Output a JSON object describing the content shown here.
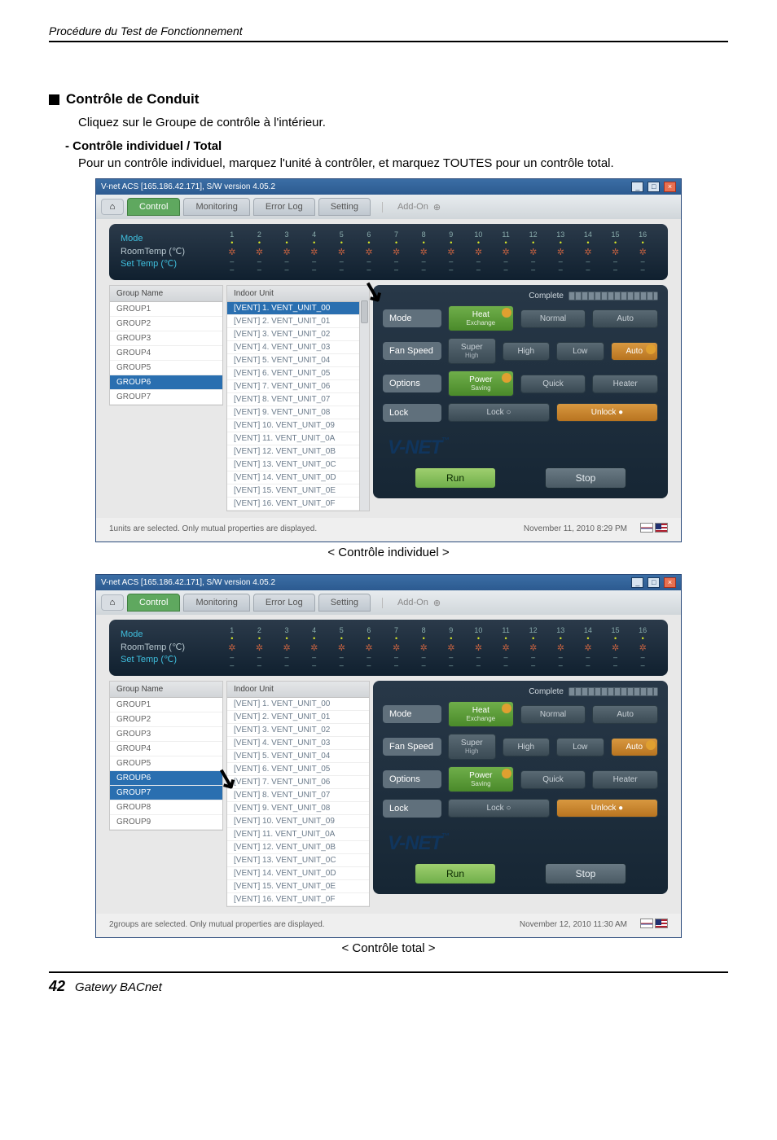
{
  "page": {
    "running_header": "Procédure du Test de Fonctionnement",
    "section_title": "Contrôle de Conduit",
    "intro": "Cliquez sur le Groupe de contrôle à l'intérieur.",
    "sub_title": "- Contrôle individuel / Total",
    "sub_body": "Pour un contrôle individuel, marquez l'unité à contrôler, et marquez TOUTES pour un contrôle total.",
    "caption1": "< Contrôle individuel >",
    "caption2": "< Contrôle total >",
    "footer_page": "42",
    "footer_product": "Gatewy BACnet"
  },
  "app": {
    "titlebar": "V-net ACS [165.186.42.171],   S/W version 4.05.2",
    "tabs": {
      "control": "Control",
      "monitoring": "Monitoring",
      "errorlog": "Error Log",
      "setting": "Setting",
      "addon": "Add-On"
    },
    "status_labels": {
      "mode": "Mode",
      "roomtemp": "RoomTemp (℃)",
      "settemp": "Set Temp   (℃)"
    },
    "status_cols": [
      "1",
      "2",
      "3",
      "4",
      "5",
      "6",
      "7",
      "8",
      "9",
      "10",
      "11",
      "12",
      "13",
      "14",
      "15",
      "16"
    ],
    "group_header": "Group Name",
    "unit_header": "Indoor Unit",
    "groups_a": [
      "GROUP1",
      "GROUP2",
      "GROUP3",
      "GROUP4",
      "GROUP5",
      "GROUP6",
      "GROUP7"
    ],
    "groups_a_selected": 5,
    "groups_b": [
      "GROUP1",
      "GROUP2",
      "GROUP3",
      "GROUP4",
      "GROUP5",
      "GROUP6",
      "GROUP7",
      "GROUP8",
      "GROUP9"
    ],
    "groups_b_selected_a": 5,
    "groups_b_selected_b": 6,
    "units": [
      "[VENT] 1. VENT_UNIT_00",
      "[VENT] 2. VENT_UNIT_01",
      "[VENT] 3. VENT_UNIT_02",
      "[VENT] 4. VENT_UNIT_03",
      "[VENT] 5. VENT_UNIT_04",
      "[VENT] 6. VENT_UNIT_05",
      "[VENT] 7. VENT_UNIT_06",
      "[VENT] 8. VENT_UNIT_07",
      "[VENT] 9. VENT_UNIT_08",
      "[VENT] 10. VENT_UNIT_09",
      "[VENT] 11. VENT_UNIT_0A",
      "[VENT] 12. VENT_UNIT_0B",
      "[VENT] 13. VENT_UNIT_0C",
      "[VENT] 14. VENT_UNIT_0D",
      "[VENT] 15. VENT_UNIT_0E",
      "[VENT] 16. VENT_UNIT_0F"
    ],
    "units_selected_a": 0,
    "complete_label": "Complete",
    "ctrl": {
      "mode": "Mode",
      "mode_btn1a": "Heat",
      "mode_btn1b": "Exchange",
      "mode_btn2": "Normal",
      "mode_btn3": "Auto",
      "fan": "Fan Speed",
      "fan_btn1a": "Super",
      "fan_btn1b": "High",
      "fan_btn2": "High",
      "fan_btn3": "Low",
      "fan_btn4": "Auto",
      "opt": "Options",
      "opt_btn1a": "Power",
      "opt_btn1b": "Saving",
      "opt_btn2": "Quick",
      "opt_btn3": "Heater",
      "lock": "Lock",
      "lock_btn1": "Lock",
      "lock_btn2": "Unlock"
    },
    "logo": "V-NET",
    "logo_tm": "™",
    "run": "Run",
    "stop": "Stop",
    "status1": "1units are selected. Only mutual properties are displayed.",
    "status1_time": "November 11, 2010  8:29 PM",
    "status2": "2groups are selected. Only mutual properties are displayed.",
    "status2_time": "November 12, 2010  11:30 AM"
  }
}
